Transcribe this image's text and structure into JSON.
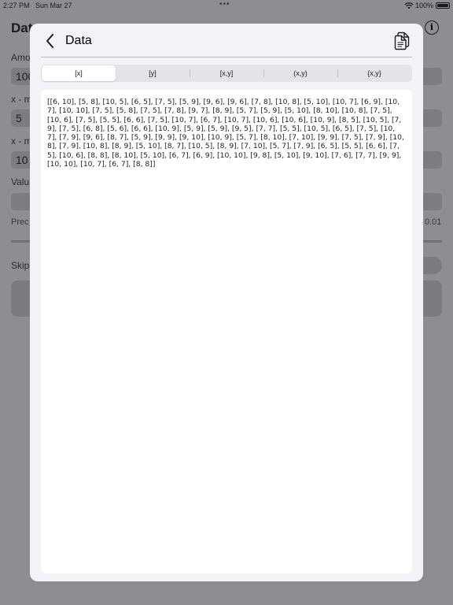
{
  "status_bar": {
    "time": "2:27 PM",
    "date": "Sun Mar 27",
    "dots": "•••",
    "battery": "100%"
  },
  "background": {
    "title": "Dat",
    "labels": {
      "amount": "Amo",
      "x_min": "x - m",
      "x_max": "x - m",
      "values": "Valu",
      "precision": "Prec",
      "skip": "Skip"
    },
    "fields": {
      "amount_value": "100",
      "x_min_value": "5",
      "x_max_value": "10"
    },
    "precision_value": "0.01"
  },
  "sheet": {
    "title": "Data",
    "tabs": [
      "[x]",
      "[y]",
      "[x,y]",
      "(x,y)",
      "{x,y}"
    ],
    "active_tab": 0,
    "data_text": "[[6, 10], [5, 8], [10, 5], [6, 5], [7, 5], [5, 9], [9, 6], [9, 6], [7, 8], [10, 8], [5, 10], [10, 7], [6, 9], [10, 7], [10, 10], [7, 5], [5, 8], [7, 5], [7, 8], [9, 7], [8, 9], [5, 7], [5, 9], [5, 10], [8, 10], [10, 8], [7, 5], [10, 6], [7, 5], [5, 5], [6, 6], [7, 5], [10, 7], [6, 7], [10, 7], [10, 6], [10, 6], [10, 9], [8, 5], [10, 5], [7, 9], [7, 5], [6, 8], [5, 6], [6, 6], [10, 9], [5, 9], [5, 9], [9, 5], [7, 7], [5, 5], [10, 5], [6, 5], [7, 5], [10, 7], [7, 9], [9, 6], [8, 7], [5, 9], [9, 9], [9, 10], [10, 9], [5, 7], [8, 10], [7, 10], [9, 9], [7, 5], [7, 9], [10, 8], [7, 9], [10, 8], [8, 9], [5, 10], [8, 7], [10, 5], [8, 9], [7, 10], [5, 7], [7, 9], [6, 5], [5, 5], [6, 6], [7, 5], [10, 6], [8, 8], [8, 10], [5, 10], [6, 7], [6, 9], [10, 10], [9, 8], [5, 10], [9, 10], [7, 6], [7, 7], [9, 9], [10, 10], [10, 7], [6, 7], [8, 8]]"
  }
}
